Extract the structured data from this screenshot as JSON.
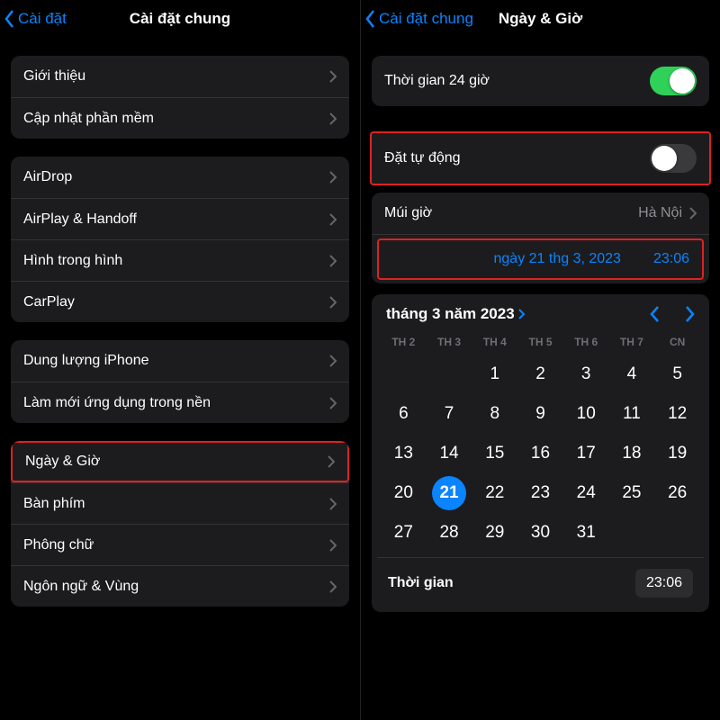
{
  "left": {
    "back": "Cài đặt",
    "title": "Cài đặt chung",
    "g1": [
      {
        "label": "Giới thiệu"
      },
      {
        "label": "Cập nhật phần mềm"
      }
    ],
    "g2": [
      {
        "label": "AirDrop"
      },
      {
        "label": "AirPlay & Handoff"
      },
      {
        "label": "Hình trong hình"
      },
      {
        "label": "CarPlay"
      }
    ],
    "g3": [
      {
        "label": "Dung lượng iPhone"
      },
      {
        "label": "Làm mới ứng dụng trong nền"
      }
    ],
    "g4": [
      {
        "label": "Ngày & Giờ",
        "highlight": true
      },
      {
        "label": "Bàn phím"
      },
      {
        "label": "Phông chữ"
      },
      {
        "label": "Ngôn ngữ & Vùng"
      }
    ]
  },
  "right": {
    "back": "Cài đặt chung",
    "title": "Ngày & Giờ",
    "twentyFourHour": {
      "label": "Thời gian 24 giờ",
      "on": true
    },
    "autoSet": {
      "label": "Đặt tự động",
      "on": false
    },
    "timezone": {
      "label": "Múi giờ",
      "value": "Hà Nội"
    },
    "dateDisplay": "ngày 21 thg 3, 2023",
    "timeDisplay": "23:06",
    "calendar": {
      "monthLabel": "tháng 3 năm 2023",
      "dow": [
        "TH 2",
        "TH 3",
        "TH 4",
        "TH 5",
        "TH 6",
        "TH 7",
        "CN"
      ],
      "startOffset": 2,
      "daysInMonth": 31,
      "selected": 21,
      "timeLabel": "Thời gian",
      "timeValue": "23:06"
    }
  }
}
